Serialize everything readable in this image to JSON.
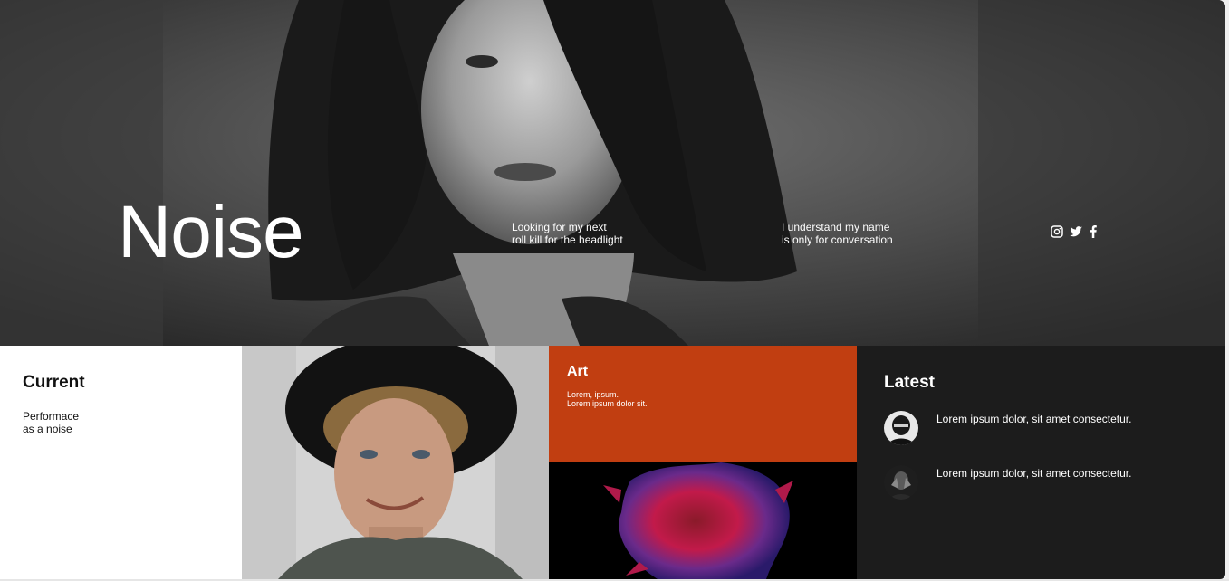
{
  "hero": {
    "title": "Noise",
    "text_1": [
      "Looking for my next",
      "roll kill for the headlight"
    ],
    "text_2": [
      "I understand my name",
      "is only for conversation"
    ],
    "social_icons": [
      "instagram-icon",
      "twitter-icon",
      "facebook-icon"
    ]
  },
  "current": {
    "heading": "Current",
    "lines": [
      "Performace",
      "as a noise"
    ]
  },
  "art": {
    "heading": "Art",
    "lines": [
      "Lorem, ipsum.",
      "Lorem ipsum dolor sit."
    ]
  },
  "latest": {
    "heading": "Latest",
    "items": [
      {
        "text": "Lorem ipsum dolor, sit amet consectetur."
      },
      {
        "text": "Lorem ipsum dolor, sit amet consectetur."
      }
    ]
  },
  "colors": {
    "art_bg": "#c13e11",
    "latest_bg": "#1c1c1c",
    "white": "#ffffff"
  }
}
